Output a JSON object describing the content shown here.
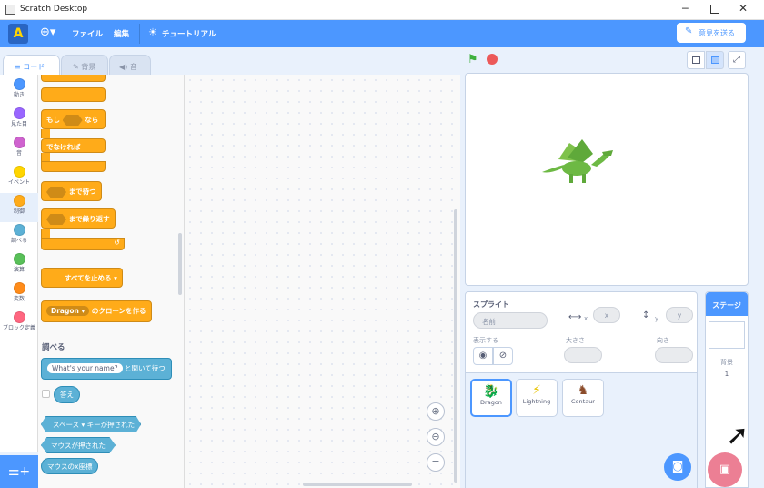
{
  "window": {
    "title": "Scratch Desktop"
  },
  "menu": {
    "file": "ファイル",
    "edit": "編集",
    "tutorial": "チュートリアル",
    "feedback": "意見を送る"
  },
  "tabs": {
    "code": "コード",
    "costumes": "背景",
    "sounds": "音"
  },
  "categories": [
    {
      "label": "動き",
      "color": "#4c97ff"
    },
    {
      "label": "見た目",
      "color": "#9966ff"
    },
    {
      "label": "音",
      "color": "#cf63cf"
    },
    {
      "label": "イベント",
      "color": "#ffd500"
    },
    {
      "label": "制御",
      "color": "#ffab19"
    },
    {
      "label": "調べる",
      "color": "#5cb1d6"
    },
    {
      "label": "演算",
      "color": "#59c059"
    },
    {
      "label": "変数",
      "color": "#ff8c1a"
    },
    {
      "label": "ブロック定義",
      "color": "#ff6680"
    }
  ],
  "blocks": {
    "if_label": "もし",
    "then_label": "なら",
    "else_label": "でなければ",
    "wait_until": "まで待つ",
    "repeat_until": "まで繰り返す",
    "stop_all": "すべてを止める",
    "clone_target": "Dragon",
    "create_clone": "のクローンを作る",
    "sensing_header": "調べる",
    "ask_question": "What's your name?",
    "ask_wait": "と聞いて待つ",
    "answer": "答え",
    "key_space": "スペース",
    "key_pressed": "キーが押された",
    "mouse_down": "マウスが押された",
    "mouse_x": "マウスのx座標"
  },
  "sprite_info": {
    "sprite_label": "スプライト",
    "name_placeholder": "名前",
    "x_placeholder": "x",
    "y_placeholder": "y",
    "x_axis": "x",
    "y_axis": "y",
    "show_label": "表示する",
    "size_label": "大きさ",
    "direction_label": "向き"
  },
  "sprites": [
    "Dragon",
    "Lightning",
    "Centaur"
  ],
  "stage_panel": {
    "header": "ステージ",
    "backdrops_label": "背景",
    "backdrop_count": "1"
  }
}
